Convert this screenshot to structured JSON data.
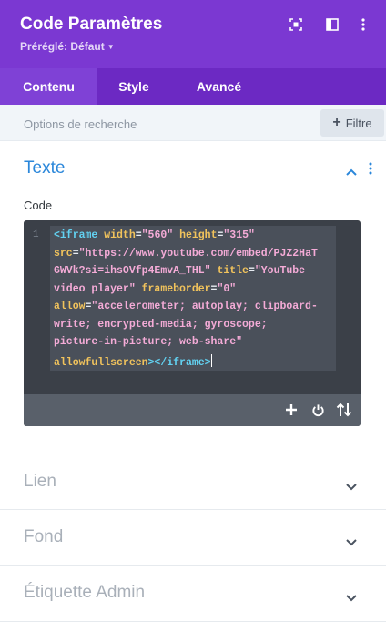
{
  "header": {
    "title": "Code Paramètres",
    "preset_label": "Préréglé: Défaut",
    "icons": [
      "expand-icon",
      "sidebar-layout-icon",
      "more-vertical-icon"
    ]
  },
  "tabs": [
    {
      "label": "Contenu",
      "active": true
    },
    {
      "label": "Style",
      "active": false
    },
    {
      "label": "Avancé",
      "active": false
    }
  ],
  "search": {
    "placeholder": "Options de recherche",
    "value": ""
  },
  "filter": {
    "label": "Filtre",
    "icon": "plus-icon"
  },
  "section_texte": {
    "title": "Texte",
    "expanded": true,
    "field_label": "Code",
    "editor": {
      "line_number": "1",
      "code": "<iframe width=\"560\" height=\"315\" src=\"https://www.youtube.com/embed/PJZ2HaTGWVk?si=ihsOVfp4EmvA_THL\" title=\"YouTube video player\" frameborder=\"0\" allow=\"accelerometer; autoplay; clipboard-write; encrypted-media; gyroscope; picture-in-picture; web-share\" allowfullscreen></iframe>",
      "lines": [
        [
          {
            "t": "tag",
            "v": "<iframe "
          },
          {
            "t": "attr",
            "v": "width"
          },
          {
            "t": "plain",
            "v": "="
          },
          {
            "t": "val",
            "v": "\"560\""
          },
          {
            "t": "plain",
            "v": " "
          },
          {
            "t": "attr",
            "v": "height"
          },
          {
            "t": "plain",
            "v": "="
          },
          {
            "t": "val",
            "v": "\"315\""
          }
        ],
        [
          {
            "t": "attr",
            "v": "src"
          },
          {
            "t": "plain",
            "v": "="
          },
          {
            "t": "val",
            "v": "\"https://www.youtube.com/embed/PJZ2HaT"
          }
        ],
        [
          {
            "t": "val",
            "v": "GWVk?si=ihsOVfp4EmvA_THL\""
          },
          {
            "t": "plain",
            "v": " "
          },
          {
            "t": "attr",
            "v": "title"
          },
          {
            "t": "plain",
            "v": "="
          },
          {
            "t": "val",
            "v": "\"YouTube"
          }
        ],
        [
          {
            "t": "val",
            "v": "video player\""
          },
          {
            "t": "plain",
            "v": " "
          },
          {
            "t": "attr",
            "v": "frameborder"
          },
          {
            "t": "plain",
            "v": "="
          },
          {
            "t": "val",
            "v": "\"0\""
          }
        ],
        [
          {
            "t": "attr",
            "v": "allow"
          },
          {
            "t": "plain",
            "v": "="
          },
          {
            "t": "val",
            "v": "\"accelerometer; autoplay; clipboard-"
          }
        ],
        [
          {
            "t": "val",
            "v": "write; encrypted-media; gyroscope;"
          }
        ],
        [
          {
            "t": "val",
            "v": "picture-in-picture; web-share\""
          }
        ],
        [
          {
            "t": "attr",
            "v": "allowfullscreen"
          },
          {
            "t": "tag",
            "v": "></iframe>"
          }
        ]
      ],
      "toolbar_icons": [
        "add-icon",
        "power-icon",
        "sort-icon"
      ]
    }
  },
  "sections": [
    {
      "title": "Lien",
      "expanded": false
    },
    {
      "title": "Fond",
      "expanded": false
    },
    {
      "title": "Étiquette Admin",
      "expanded": false
    }
  ],
  "colors": {
    "header_purple": "#7b38d2",
    "tab_bar_purple": "#6c29c3",
    "active_tab": "#7f41d6",
    "section_open_blue": "#2b87da",
    "section_closed_gray": "#a9b0b9"
  }
}
